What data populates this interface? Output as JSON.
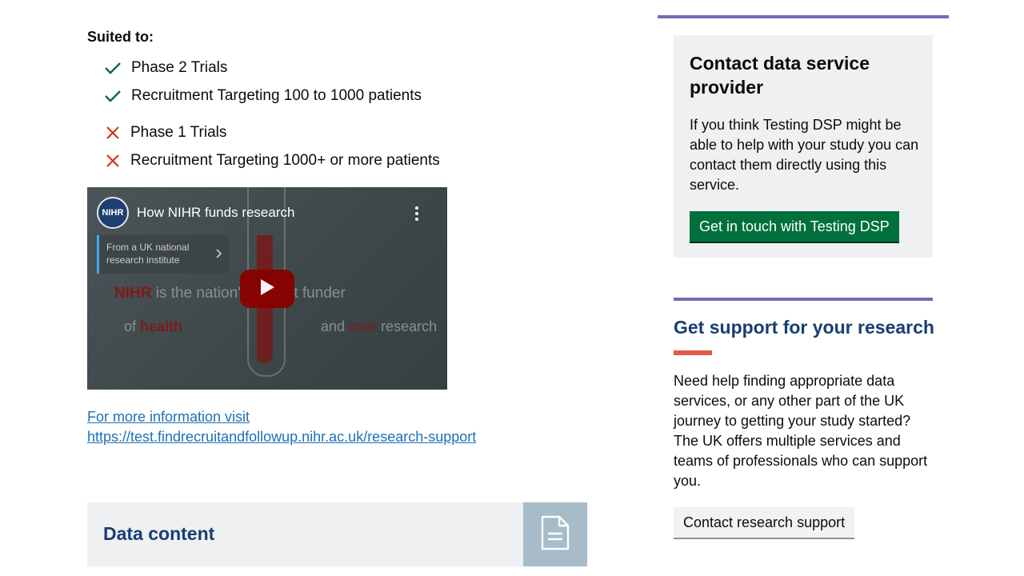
{
  "suited": {
    "label": "Suited to:",
    "positives": [
      "Phase 2 Trials",
      "Recruitment Targeting 100 to 1000 patients"
    ],
    "negatives": [
      "Phase 1 Trials",
      "Recruitment Targeting 1000+ or more patients"
    ],
    "positive_icon": "check-icon",
    "negative_icon": "cross-icon",
    "positive_color": "#00703c",
    "negative_color": "#d4351c"
  },
  "video": {
    "channel_logo_text": "NIHR",
    "title": "How NIHR funds research",
    "info_card": "From a UK national research institute",
    "bg_text_1_red": "NIHR",
    "bg_text_1_rest": " is the nation's largest funder",
    "bg_text_2_pre": "of ",
    "bg_text_2_red": "health",
    "bg_text_3_pre": "and ",
    "bg_text_3_red": "care",
    "bg_text_3_post": " research"
  },
  "more_info": {
    "line1": "For more information visit",
    "line2": "https://test.findrecruitandfollowup.nihr.ac.uk/research-support"
  },
  "data_content": {
    "title": "Data content",
    "icon": "document-icon"
  },
  "contact": {
    "title": "Contact data service provider",
    "body": "If you think Testing DSP might be able to help with your study you can contact them directly using this service.",
    "button": "Get in touch with Testing DSP"
  },
  "support": {
    "title": "Get support for your research",
    "body": "Need help finding appropriate data services, or any other part of the UK journey to getting your study started? The UK offers multiple services and teams of professionals who can support you.",
    "button": "Contact research support"
  },
  "colors": {
    "accent_rule": "#6e6fb0",
    "heading_blue": "#193e72",
    "link_blue": "#1d70b8",
    "button_green": "#00703c",
    "accent_red": "#e5584b"
  }
}
